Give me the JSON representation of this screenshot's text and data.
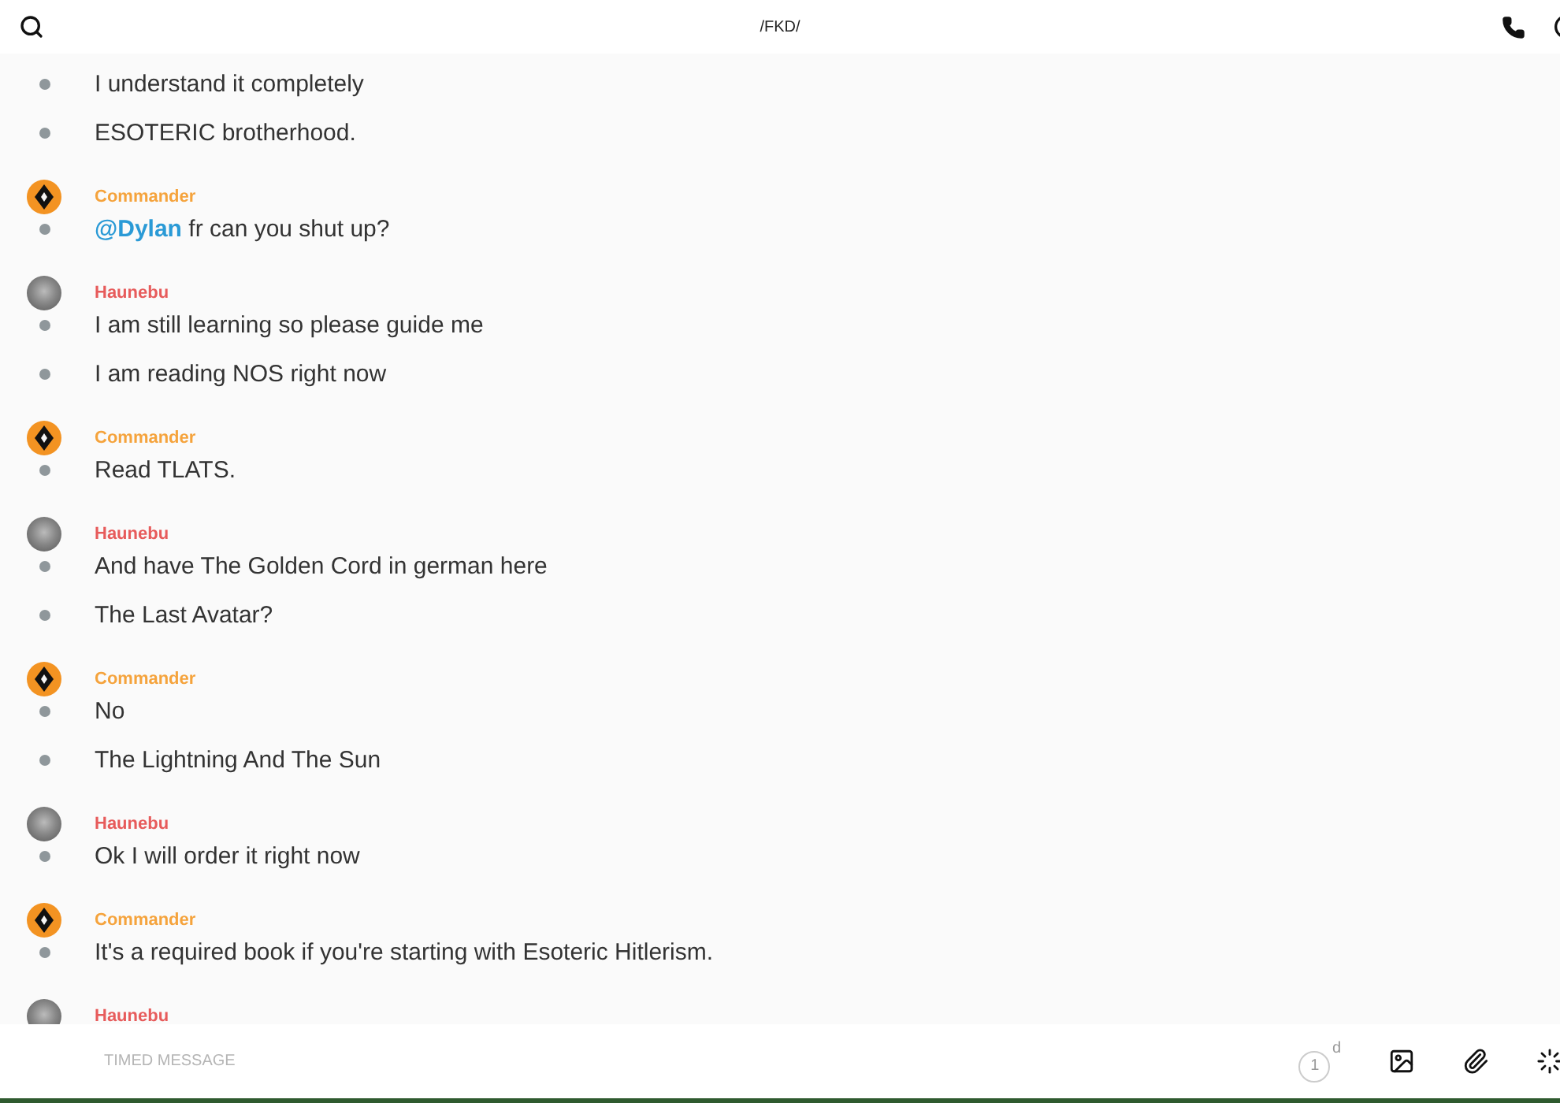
{
  "header": {
    "title": "/FKD/"
  },
  "groups": [
    {
      "messages": [
        [
          {
            "kind": "text",
            "text": "I understand it completely"
          }
        ],
        [
          {
            "kind": "text",
            "text": "ESOTERIC brotherhood."
          }
        ]
      ]
    },
    {
      "author": "Commander",
      "kind": "emblem",
      "color": "#f5a33c",
      "messages": [
        [
          {
            "kind": "mention",
            "text": "@Dylan"
          },
          {
            "kind": "text",
            "text": " fr can you shut up?"
          }
        ]
      ]
    },
    {
      "author": "Haunebu",
      "kind": "photo",
      "color": "#e75b5b",
      "messages": [
        [
          {
            "kind": "text",
            "text": "I am still learning so please guide me"
          }
        ],
        [
          {
            "kind": "text",
            "text": "I am reading NOS right now"
          }
        ]
      ]
    },
    {
      "author": "Commander",
      "kind": "emblem",
      "color": "#f5a33c",
      "messages": [
        [
          {
            "kind": "text",
            "text": "Read TLATS."
          }
        ]
      ]
    },
    {
      "author": "Haunebu",
      "kind": "photo",
      "color": "#e75b5b",
      "messages": [
        [
          {
            "kind": "text",
            "text": "And have The Golden Cord in german here"
          }
        ],
        [
          {
            "kind": "text",
            "text": "The Last Avatar?"
          }
        ]
      ]
    },
    {
      "author": "Commander",
      "kind": "emblem",
      "color": "#f5a33c",
      "messages": [
        [
          {
            "kind": "text",
            "text": "No"
          }
        ],
        [
          {
            "kind": "text",
            "text": "The Lightning And The Sun"
          }
        ]
      ]
    },
    {
      "author": "Haunebu",
      "kind": "photo",
      "color": "#e75b5b",
      "messages": [
        [
          {
            "kind": "text",
            "text": "Ok I will order it right now"
          }
        ]
      ]
    },
    {
      "author": "Commander",
      "kind": "emblem",
      "color": "#f5a33c",
      "messages": [
        [
          {
            "kind": "text",
            "text": "It's a required book if you're starting with Esoteric Hitlerism."
          }
        ]
      ]
    },
    {
      "author": "Haunebu",
      "kind": "photo",
      "color": "#e75b5b"
    }
  ],
  "composer": {
    "placeholder": "TIMED MESSAGE",
    "timer_value": "1",
    "timer_unit": "d"
  }
}
